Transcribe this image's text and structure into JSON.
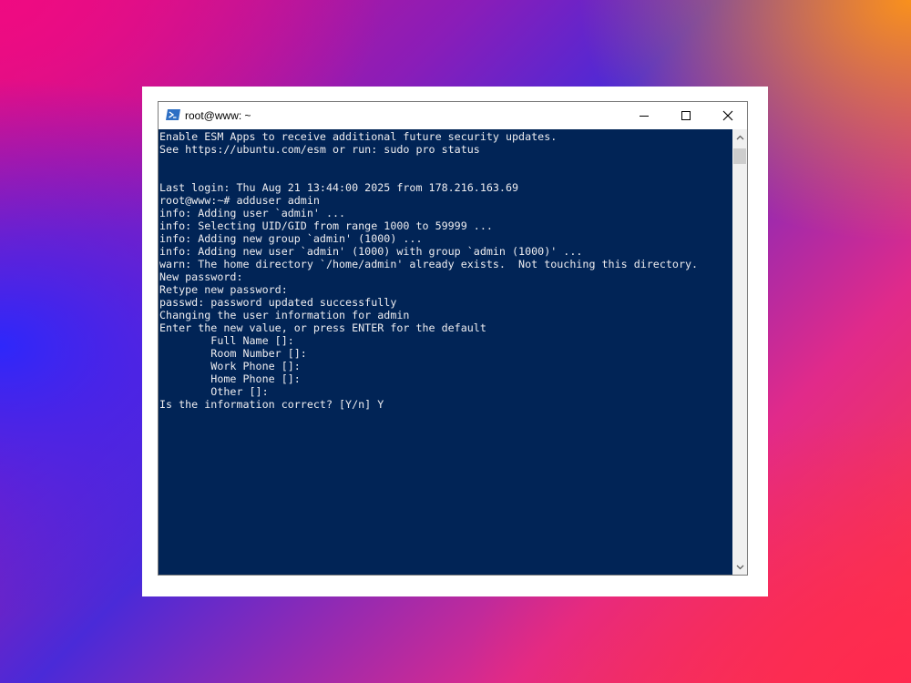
{
  "window": {
    "title": "root@www: ~",
    "icon": "powershell-icon",
    "buttons": {
      "minimize": "minimize-icon",
      "maximize": "maximize-icon",
      "close": "close-icon"
    }
  },
  "terminal": {
    "background": "#012456",
    "foreground": "#eeedf0",
    "lines": [
      "Enable ESM Apps to receive additional future security updates.",
      "See https://ubuntu.com/esm or run: sudo pro status",
      "",
      "",
      "Last login: Thu Aug 21 13:44:00 2025 from 178.216.163.69",
      "root@www:~# adduser admin",
      "info: Adding user `admin' ...",
      "info: Selecting UID/GID from range 1000 to 59999 ...",
      "info: Adding new group `admin' (1000) ...",
      "info: Adding new user `admin' (1000) with group `admin (1000)' ...",
      "warn: The home directory `/home/admin' already exists.  Not touching this directory.",
      "New password:",
      "Retype new password:",
      "passwd: password updated successfully",
      "Changing the user information for admin",
      "Enter the new value, or press ENTER for the default",
      "        Full Name []:",
      "        Room Number []:",
      "        Work Phone []:",
      "        Home Phone []:",
      "        Other []:",
      "Is the information correct? [Y/n] Y"
    ]
  }
}
